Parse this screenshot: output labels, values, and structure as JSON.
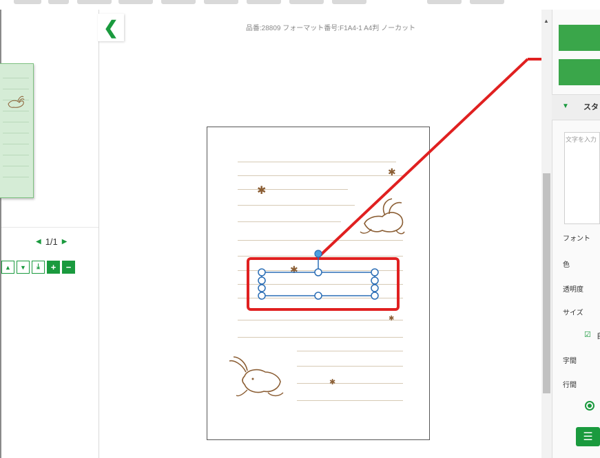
{
  "canvas": {
    "title": "品番:28809 フォーマット番号:F1A4-1 A4判 ノーカット"
  },
  "left_panel": {
    "pager": {
      "prev": "◀",
      "label": "1/1",
      "next": "▶"
    },
    "tools": [
      {
        "name": "move-up-button",
        "glyph": "▲"
      },
      {
        "name": "move-down-button",
        "glyph": "▼"
      },
      {
        "name": "move-bottom-button",
        "glyph": "⤓"
      },
      {
        "name": "add-page-button",
        "glyph": "+"
      },
      {
        "name": "remove-page-button",
        "glyph": "−"
      }
    ]
  },
  "collapse": {
    "glyph": "❮"
  },
  "right_panel": {
    "style_section_label": "スタ",
    "text_placeholder": "文字を入力",
    "font_label": "フォント",
    "color_label": "色",
    "opacity_label": "透明度",
    "size_label": "サイズ",
    "check_tail": "自",
    "char_spacing_label": "字間",
    "line_spacing_label": "行間"
  },
  "colors": {
    "accent": "#1a9a3e",
    "highlight": "#e02020",
    "selection": "#2a6db5"
  }
}
